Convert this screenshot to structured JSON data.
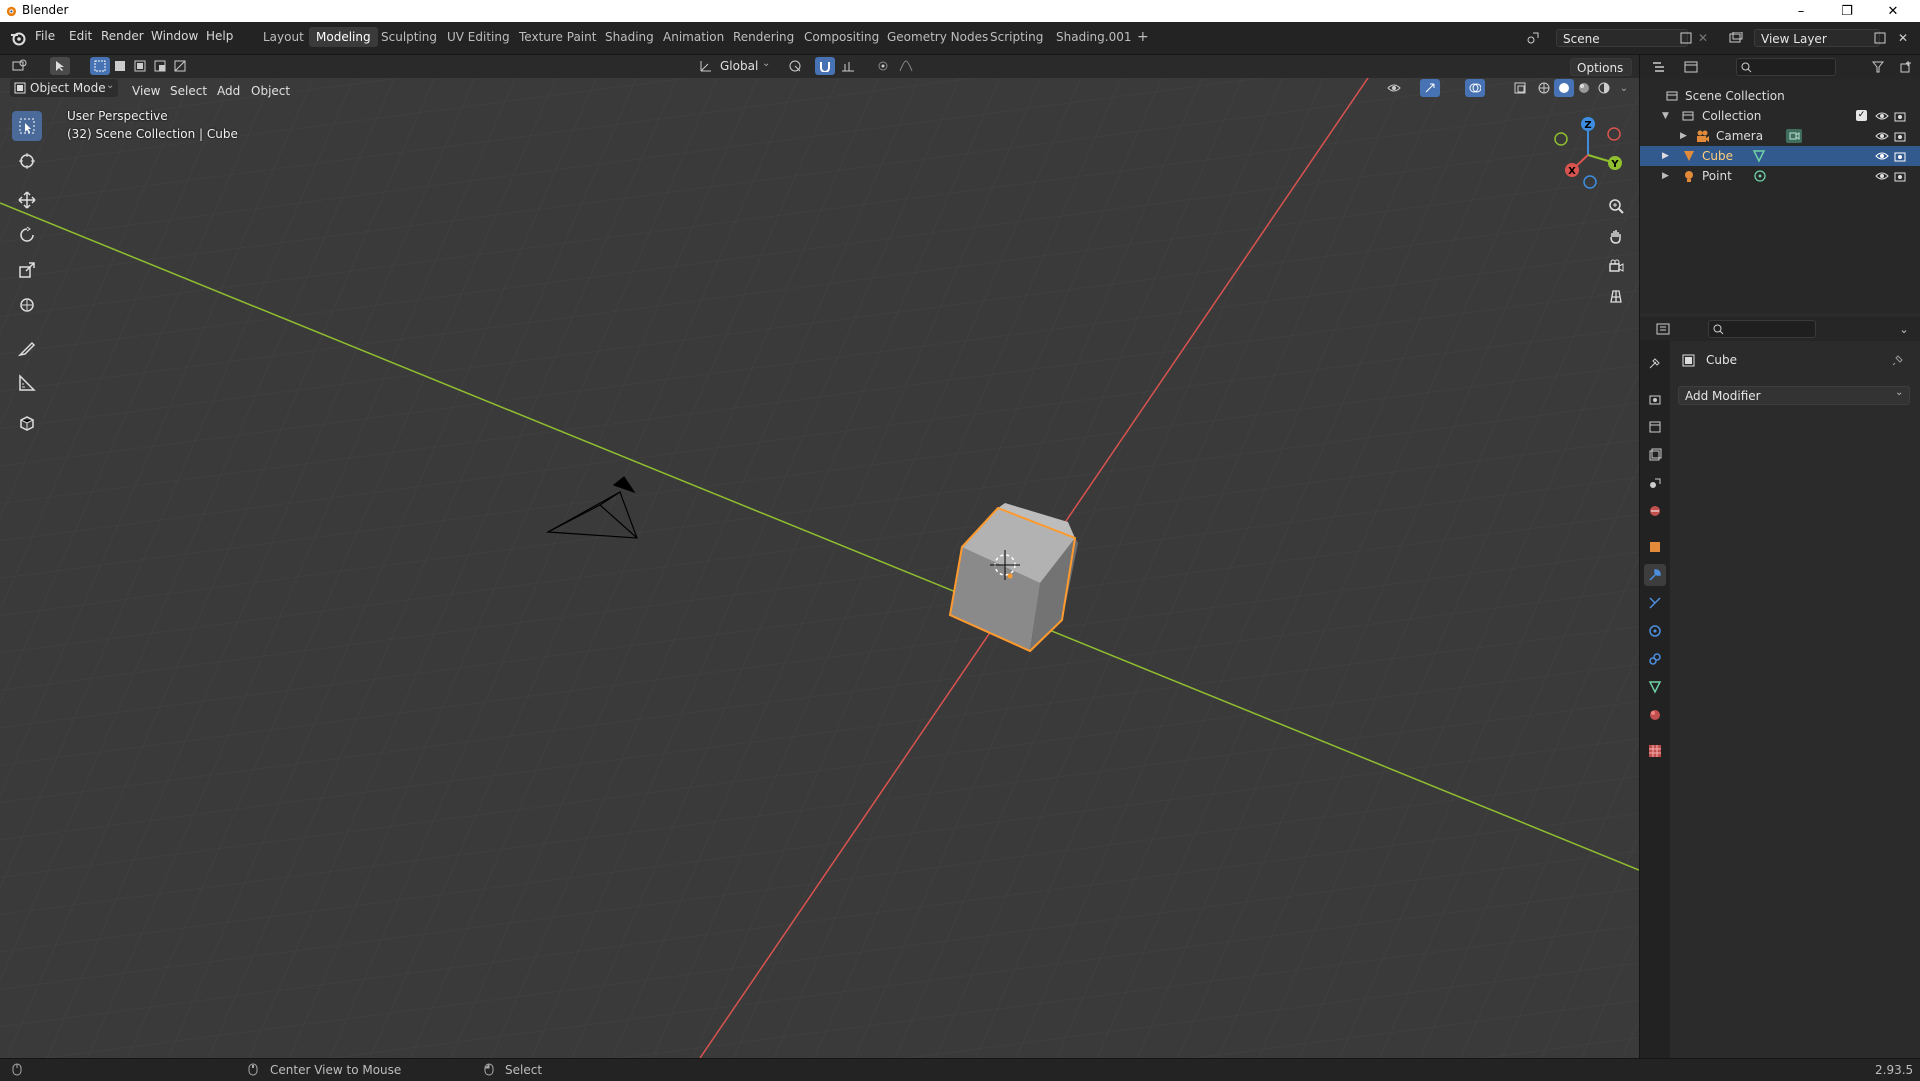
{
  "window": {
    "title": "Blender",
    "controls": [
      "–",
      "❐",
      "✕"
    ]
  },
  "menubar": {
    "items": [
      "File",
      "Edit",
      "Render",
      "Window",
      "Help"
    ]
  },
  "workspaces": {
    "tabs": [
      "Layout",
      "Modeling",
      "Sculpting",
      "UV Editing",
      "Texture Paint",
      "Shading",
      "Animation",
      "Rendering",
      "Compositing",
      "Geometry Nodes",
      "Scripting",
      "Shading.001"
    ],
    "active": "Modeling",
    "add_label": "+"
  },
  "scene": {
    "scene_name": "Scene",
    "view_layer": "View Layer"
  },
  "viewport": {
    "mode": "Object Mode",
    "menus": [
      "View",
      "Select",
      "Add",
      "Object"
    ],
    "transform_orientation": "Global",
    "options_label": "Options",
    "overlay_line1": "User Perspective",
    "overlay_line2": "(32) Scene Collection | Cube",
    "gizmo_axes": {
      "x": "X",
      "y": "Y",
      "z": "Z"
    }
  },
  "outliner": {
    "root": "Scene Collection",
    "collection": "Collection",
    "items": [
      {
        "name": "Camera",
        "icon": "camera-icon",
        "selected": false
      },
      {
        "name": "Cube",
        "icon": "mesh-icon",
        "selected": true
      },
      {
        "name": "Point",
        "icon": "light-icon",
        "selected": false
      }
    ]
  },
  "properties": {
    "object_name": "Cube",
    "add_modifier_label": "Add Modifier",
    "active_tab": "modifier"
  },
  "statusbar": {
    "hint1": "Center View to Mouse",
    "hint2": "Select",
    "version": "2.93.5"
  },
  "colors": {
    "accent": "#4772b3",
    "selection_outline": "#ff9a2e",
    "x_axis": "#d9534f",
    "y_axis": "#8fbf2f",
    "z_axis": "#3d8ee0"
  }
}
